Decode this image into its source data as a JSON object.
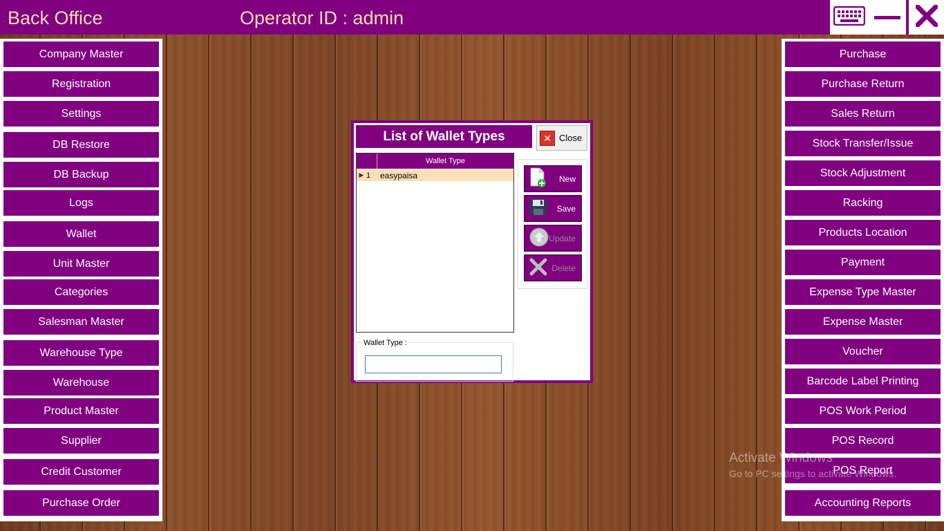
{
  "titlebar": {
    "app_title": "Back Office",
    "operator_label": "Operator ID :  admin",
    "buttons": {
      "keyboard_icon": "keyboard-icon",
      "minimize_icon": "minimize-icon",
      "close_icon": "close-icon"
    }
  },
  "left_menu": [
    "Company Master",
    "Registration",
    "Settings",
    "DB Restore",
    "DB Backup",
    "Logs",
    "Wallet",
    "Unit Master",
    "Categories",
    "Salesman Master",
    "Warehouse Type",
    "Warehouse",
    "Product Master",
    "Supplier",
    "Credit Customer",
    "Purchase Order"
  ],
  "right_menu": [
    "Purchase",
    "Purchase Return",
    "Sales Return",
    "Stock Transfer/Issue",
    "Stock Adjustment",
    "Racking",
    "Products Location",
    "Payment",
    "Expense Type Master",
    "Expense Master",
    "Voucher",
    "Barcode Label Printing",
    "POS Work Period",
    "POS Record",
    "POS Report",
    "Accounting Reports"
  ],
  "dialog": {
    "title": "List of Wallet Types",
    "close_label": "Close",
    "grid": {
      "column_header": "Wallet Type",
      "rows": [
        {
          "index": "1",
          "value": "easypaisa"
        }
      ]
    },
    "field_label": "Wallet Type :",
    "field_value": "",
    "actions": {
      "new": "New",
      "save": "Save",
      "update": "Update",
      "delete": "Delete"
    }
  },
  "watermark": {
    "title": "Activate Windows",
    "subtitle": "Go to PC settings to activate Windows."
  },
  "colors": {
    "accent": "#800080",
    "title_text": "#f5dcb4",
    "selected_row": "#fbdfb5"
  }
}
